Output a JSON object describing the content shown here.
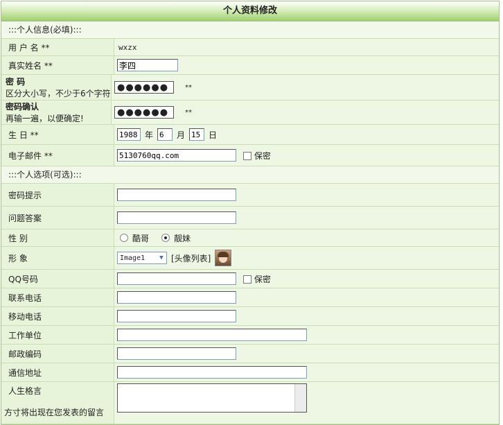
{
  "title": "个人资料修改",
  "section_required": ":::个人信息(必填):::",
  "section_optional": ":::个人选项(可选):::",
  "required_mark": "**",
  "username": {
    "label": "用 户 名 **",
    "value": "wxzx"
  },
  "realname": {
    "label": "真实姓名 **",
    "value": "李四"
  },
  "password": {
    "label": "密    码",
    "hint": "区分大小写，不少于6个字符",
    "value": "●●●●●●"
  },
  "password_confirm": {
    "label": "密码确认",
    "hint": "再输一遍，以便确定!",
    "value": "●●●●●●"
  },
  "birthday": {
    "label": "生    日 **",
    "year": "1988",
    "year_unit": "年",
    "month": "6",
    "month_unit": "月",
    "day": "15",
    "day_unit": "日"
  },
  "email": {
    "label": "电子邮件 **",
    "value": "5130760qq.com",
    "private_label": "保密"
  },
  "pw_hint": {
    "label": "密码提示",
    "value": ""
  },
  "answer": {
    "label": "问题答案",
    "value": ""
  },
  "gender": {
    "label": "性    别",
    "option1": "酷哥",
    "option2": "靓妹",
    "selected": "靓妹"
  },
  "avatar": {
    "label": "形    象",
    "select_value": "Image1",
    "list_link": "[头像列表]",
    "icon": "avatar-image"
  },
  "qq": {
    "label": "QQ号码",
    "value": "",
    "private_label": "保密"
  },
  "phone": {
    "label": "联系电话",
    "value": ""
  },
  "mobile": {
    "label": "移动电话",
    "value": ""
  },
  "workplace": {
    "label": "工作单位",
    "value": ""
  },
  "zipcode": {
    "label": "邮政编码",
    "value": ""
  },
  "address": {
    "label": "通信地址",
    "value": ""
  },
  "motto": {
    "label": "人生格言",
    "hint": "方寸将出现在您发表的留言"
  },
  "colors": {
    "header_green": "#9fcf6c",
    "row_bg": "#eef7e4",
    "label_bg": "#e8f4da",
    "border": "#c9ddb4"
  }
}
